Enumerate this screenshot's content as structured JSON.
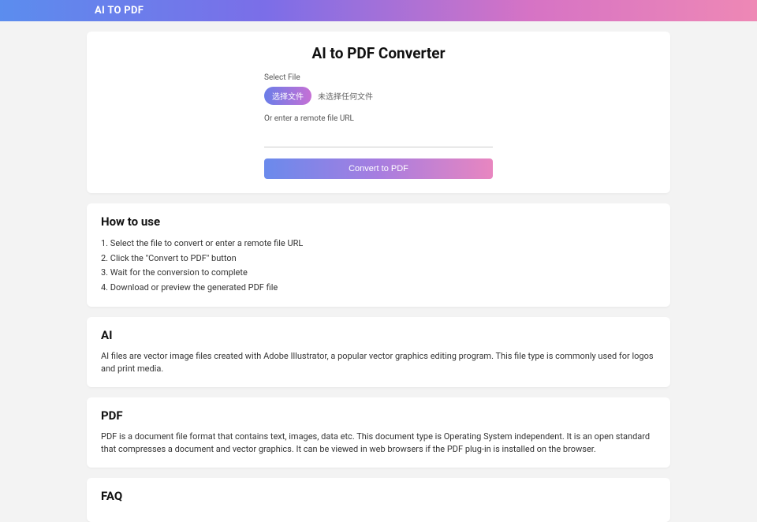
{
  "header": {
    "logo": "AI TO PDF"
  },
  "main": {
    "title": "AI to PDF Converter",
    "select_file_label": "Select File",
    "file_button": "选择文件",
    "file_status": "未选择任何文件",
    "or_label": "Or enter a remote file URL",
    "url_value": "",
    "convert_button": "Convert to PDF"
  },
  "howto": {
    "title": "How to use",
    "steps": [
      "1. Select the file to convert or enter a remote file URL",
      "2. Click the \"Convert to PDF\" button",
      "3. Wait for the conversion to complete",
      "4. Download or preview the generated PDF file"
    ]
  },
  "ai_section": {
    "title": "AI",
    "desc": "AI files are vector image files created with Adobe Illustrator, a popular vector graphics editing program. This file type is commonly used for logos and print media."
  },
  "pdf_section": {
    "title": "PDF",
    "desc": "PDF is a document file format that contains text, images, data etc. This document type is Operating System independent. It is an open standard that compresses a document and vector graphics. It can be viewed in web browsers if the PDF plug-in is installed on the browser."
  },
  "faq_section": {
    "title": "FAQ"
  }
}
